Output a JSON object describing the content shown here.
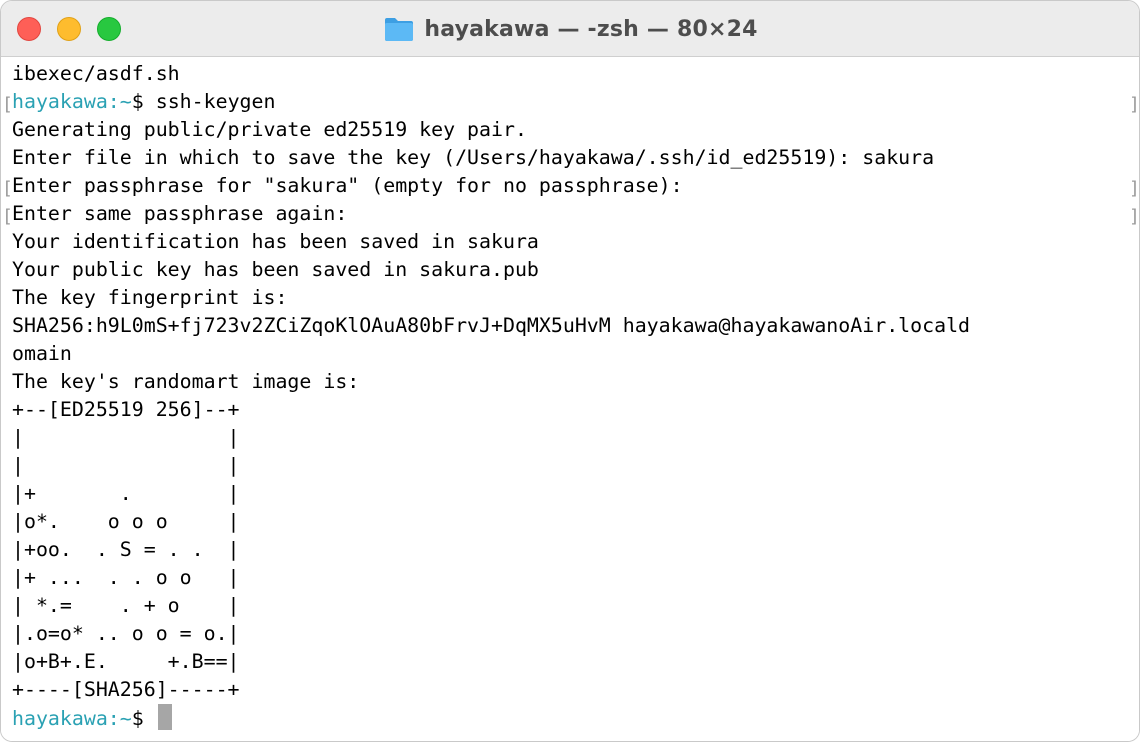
{
  "window": {
    "title": "hayakawa — -zsh — 80×24",
    "title_icon": "folder-icon",
    "folder_color": "#4fb1f2",
    "close_color": "#fe5f57",
    "minimize_color": "#febc2e",
    "zoom_color": "#28c840"
  },
  "terminal": {
    "prompt_color": "#2aa1b3",
    "prompt_user": "hayakawa:~",
    "prompt_symbol": "$",
    "command": "ssh-keygen",
    "lines": {
      "l0": "ibexec/asdf.sh",
      "l2": "Generating public/private ed25519 key pair.",
      "l3": "Enter file in which to save the key (/Users/hayakawa/.ssh/id_ed25519): sakura",
      "l4": "Enter passphrase for \"sakura\" (empty for no passphrase):",
      "l5": "Enter same passphrase again:",
      "l6": "Your identification has been saved in sakura",
      "l7": "Your public key has been saved in sakura.pub",
      "l8": "The key fingerprint is:",
      "l9": "SHA256:h9L0mS+fj723v2ZCiZqoKlOAuA80bFrvJ+DqMX5uHvM hayakawa@hayakawanoAir.locald",
      "l10": "omain",
      "l11": "The key's randomart image is:",
      "l12": "+--[ED25519 256]--+",
      "l13": "|                 |",
      "l14": "|                 |",
      "l15": "|+       .        |",
      "l16": "|o*.    o o o     |",
      "l17": "|+oo.  . S = . .  |",
      "l18": "|+ ...  . . o o   |",
      "l19": "| *.=    . + o    |",
      "l20": "|.o=o* .. o o = o.|",
      "l21": "|o+B+.E.     +.B==|",
      "l22": "+----[SHA256]-----+"
    },
    "mark_left": "[",
    "mark_right": "]"
  }
}
